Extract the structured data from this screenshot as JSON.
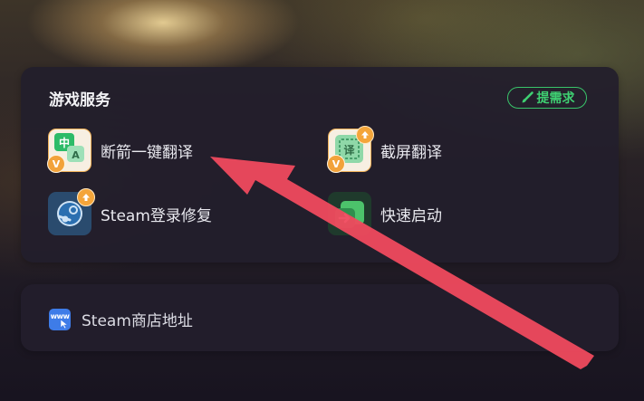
{
  "services": {
    "title": "游戏服务",
    "request_button": "提需求",
    "items": [
      {
        "label": "断箭一键翻译",
        "icon": "translate-app-icon",
        "badge": "V"
      },
      {
        "label": "截屏翻译",
        "icon": "screenshot-translate-icon",
        "badge": "V",
        "update": true
      },
      {
        "label": "Steam登录修复",
        "icon": "steam-icon",
        "update": true
      },
      {
        "label": "快速启动",
        "icon": "quick-launch-icon"
      }
    ]
  },
  "links": {
    "steam_store": "Steam商店地址",
    "www_icon_text": "www"
  },
  "colors": {
    "accent_green": "#3fd072",
    "card_bg": "#221e2c",
    "arrow_red": "#f04a5e"
  }
}
